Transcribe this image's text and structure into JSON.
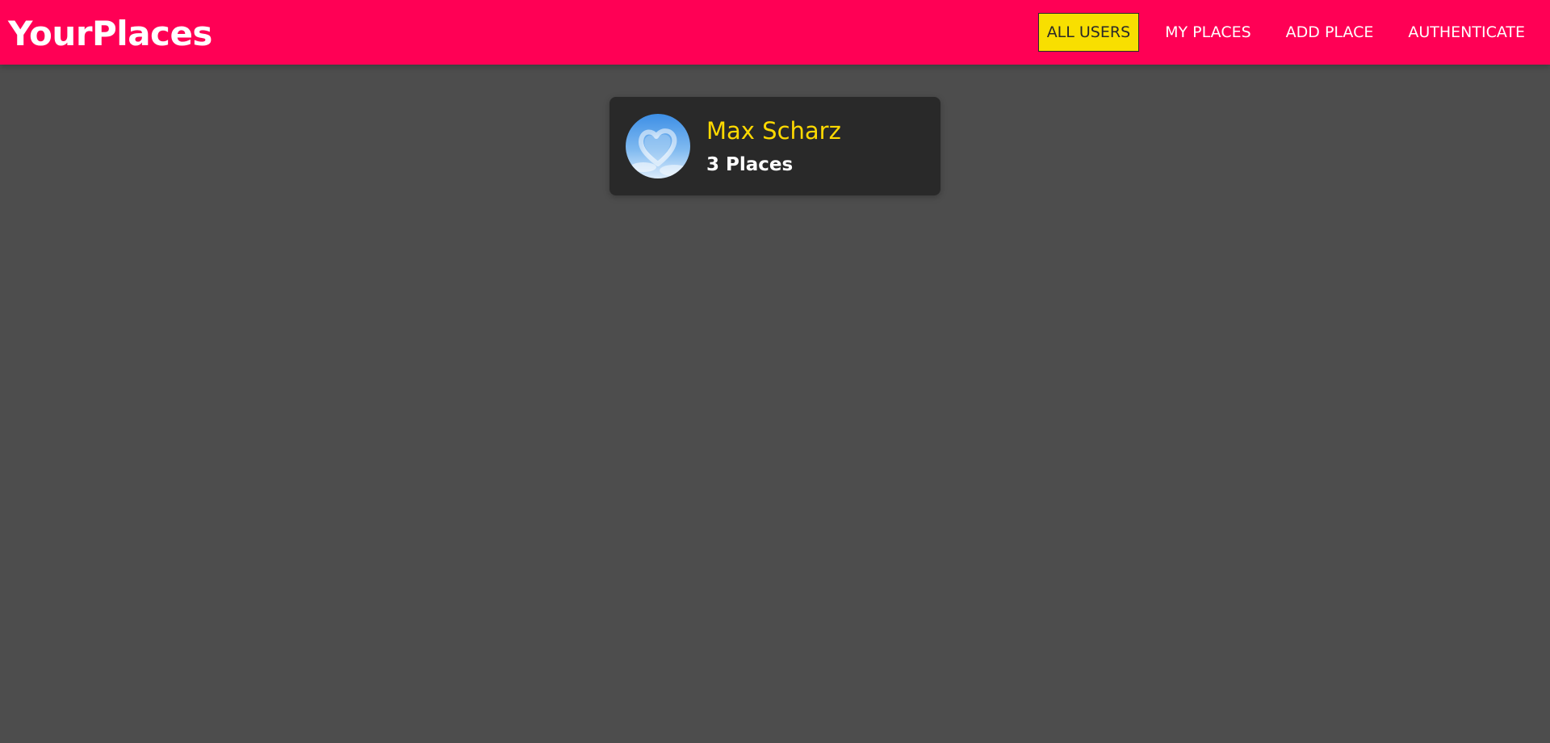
{
  "header": {
    "brand": "YourPlaces",
    "nav": [
      {
        "label": "ALL USERS",
        "active": true
      },
      {
        "label": "MY PLACES",
        "active": false
      },
      {
        "label": "ADD PLACE",
        "active": false
      },
      {
        "label": "AUTHENTICATE",
        "active": false
      }
    ]
  },
  "users": [
    {
      "name": "Max Scharz",
      "places_label": "3 Places",
      "avatar_icon": "heart-cloud-sky-image"
    }
  ],
  "colors": {
    "header_bg": "#ff0055",
    "page_bg": "#4d4d4d",
    "card_bg": "#292929",
    "active_nav_bg": "#f8df00",
    "user_name": "#ffd900"
  }
}
